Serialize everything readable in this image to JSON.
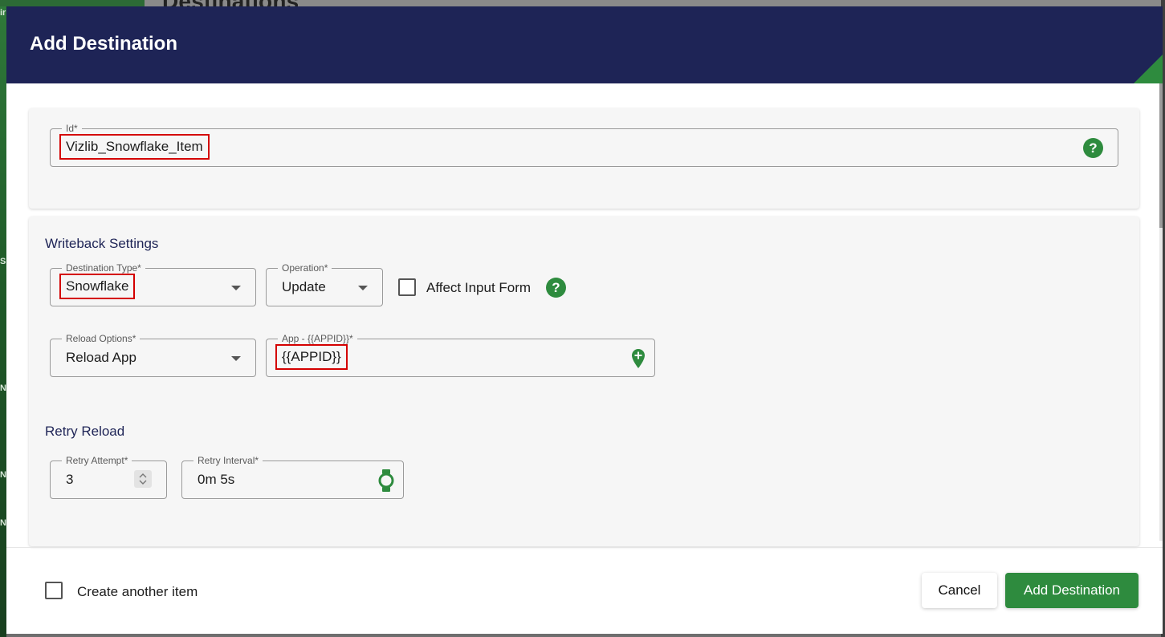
{
  "background": {
    "page_title": "Destinations",
    "side_letters": [
      "ir",
      "S",
      "N",
      "N",
      "N"
    ]
  },
  "modal": {
    "title": "Add Destination"
  },
  "id_field": {
    "label": "Id*",
    "value": "Vizlib_Snowflake_Item",
    "help_icon": "question-circle-icon"
  },
  "writeback": {
    "title": "Writeback Settings",
    "destination_type": {
      "label": "Destination Type*",
      "value": "Snowflake"
    },
    "operation": {
      "label": "Operation*",
      "value": "Update"
    },
    "affect_input_form": {
      "label": "Affect Input Form",
      "checked": false,
      "help_icon": "question-circle-icon"
    },
    "reload_options": {
      "label": "Reload Options*",
      "value": "Reload App"
    },
    "app": {
      "label": "App - {{APPID}}*",
      "value": "{{APPID}}",
      "icon": "add-location-pin-icon"
    }
  },
  "retry": {
    "title": "Retry Reload",
    "attempt": {
      "label": "Retry Attempt*",
      "value": "3"
    },
    "interval": {
      "label": "Retry Interval*",
      "value": "0m 5s",
      "icon": "watch-icon"
    }
  },
  "footer": {
    "create_another": {
      "label": "Create another item",
      "checked": false
    },
    "cancel_label": "Cancel",
    "submit_label": "Add Destination"
  },
  "colors": {
    "header_bg": "#1e2456",
    "accent_green": "#2e8b3e",
    "highlight_red": "#d40000"
  }
}
